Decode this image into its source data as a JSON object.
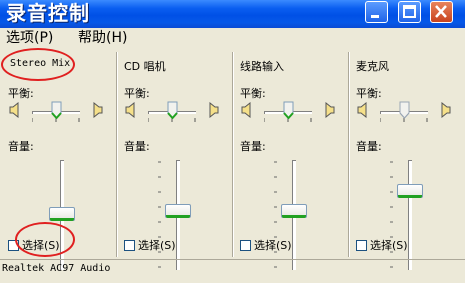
{
  "window": {
    "title": "录音控制"
  },
  "menu": {
    "options": "选项(P)",
    "help": "帮助(H)"
  },
  "panels": [
    {
      "name": "Stereo Mix",
      "balance_label": "平衡:",
      "volume_label": "音量:",
      "select_label": "选择(S)",
      "selected": true,
      "volume_level": 0.05,
      "balance": 0.5
    },
    {
      "name": "CD 唱机",
      "balance_label": "平衡:",
      "volume_label": "音量:",
      "select_label": "选择(S)",
      "selected": false,
      "volume_level": 0.12,
      "balance": 0.5
    },
    {
      "name": "线路输入",
      "balance_label": "平衡:",
      "volume_label": "音量:",
      "select_label": "选择(S)",
      "selected": false,
      "volume_level": 0.12,
      "balance": 0.5
    },
    {
      "name": "麦克风",
      "balance_label": "平衡:",
      "volume_label": "音量:",
      "select_label": "选择(S)",
      "selected": false,
      "volume_level": 0.45,
      "balance": 0.5
    }
  ],
  "status": {
    "device": "Realtek AC97 Audio"
  },
  "colors": {
    "title_bar": "#0A5EF0",
    "close_button": "#C9431E",
    "thumb_accent": "#21A121",
    "annotation": "#E02020"
  }
}
